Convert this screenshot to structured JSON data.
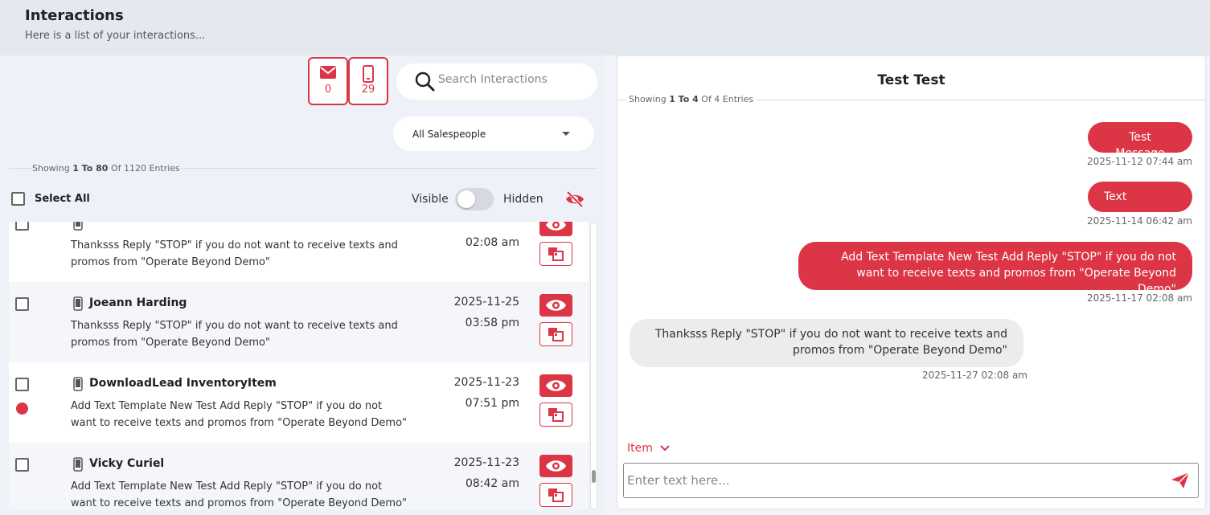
{
  "header": {
    "title": "Interactions",
    "subtitle": "Here is a list of your interactions..."
  },
  "counters": {
    "email_count": "0",
    "sms_count": "29"
  },
  "search": {
    "placeholder": "Search Interactions"
  },
  "salespeople_select": {
    "value": "All Salespeople"
  },
  "list_showing": {
    "prefix": "Showing",
    "range": "1 To 80",
    "suffix": "Of 1120 Entries"
  },
  "controls": {
    "select_all": "Select All",
    "visible": "Visible",
    "hidden": "Hidden"
  },
  "rows": [
    {
      "name": "",
      "message": "Thanksss Reply \"STOP\" if you do not want to receive texts and promos from \"Operate Beyond Demo\"",
      "date": "",
      "time": "02:08 am",
      "unread": false
    },
    {
      "name": "Joeann Harding",
      "message": "Thanksss Reply \"STOP\" if you do not want to receive texts and promos from \"Operate Beyond Demo\"",
      "date": "2025-11-25",
      "time": "03:58 pm",
      "unread": false
    },
    {
      "name": "DownloadLead InventoryItem",
      "message": "Add Text Template New Test Add Reply \"STOP\" if you do not want to receive texts and promos from \"Operate Beyond Demo\"",
      "date": "2025-11-23",
      "time": "07:51 pm",
      "unread": true
    },
    {
      "name": "Vicky Curiel",
      "message": "Add Text Template New Test Add Reply \"STOP\" if you do not want to receive texts and promos from \"Operate Beyond Demo\"",
      "date": "2025-11-23",
      "time": "08:42 am",
      "unread": false
    }
  ],
  "conversation": {
    "contact_name": "Test Test",
    "showing": {
      "prefix": "Showing",
      "range": "1 To 4",
      "suffix": "Of 4 Entries"
    },
    "messages": [
      {
        "direction": "outgoing",
        "text": "Test Message",
        "timestamp": "2025-11-12 07:44 am"
      },
      {
        "direction": "outgoing",
        "text": "Text",
        "timestamp": "2025-11-14 06:42 am"
      },
      {
        "direction": "outgoing",
        "text": "Add Text Template New Test Add Reply \"STOP\" if you do not want to receive texts and promos from \"Operate Beyond Demo\"",
        "timestamp": "2025-11-17 02:08 am"
      },
      {
        "direction": "incoming",
        "text": "Thanksss Reply \"STOP\" if you do not want to receive texts and promos from \"Operate Beyond Demo\"",
        "timestamp": "2025-11-27 02:08 am"
      }
    ],
    "item_dropdown": "Item",
    "composer_placeholder": "Enter text here..."
  },
  "icons": {
    "mail": "mail-icon",
    "phone": "mobile-phone-icon",
    "search": "search-icon",
    "eye_off": "eye-slash-icon",
    "eye": "eye-icon",
    "copy": "copy-icon",
    "send": "paper-plane-icon",
    "chevron": "chevron-down-icon"
  },
  "colors": {
    "accent": "#dc3545",
    "header_bg": "#e4e8ef",
    "panel_bg": "#eef1f8",
    "incoming_bubble": "#ececec"
  }
}
